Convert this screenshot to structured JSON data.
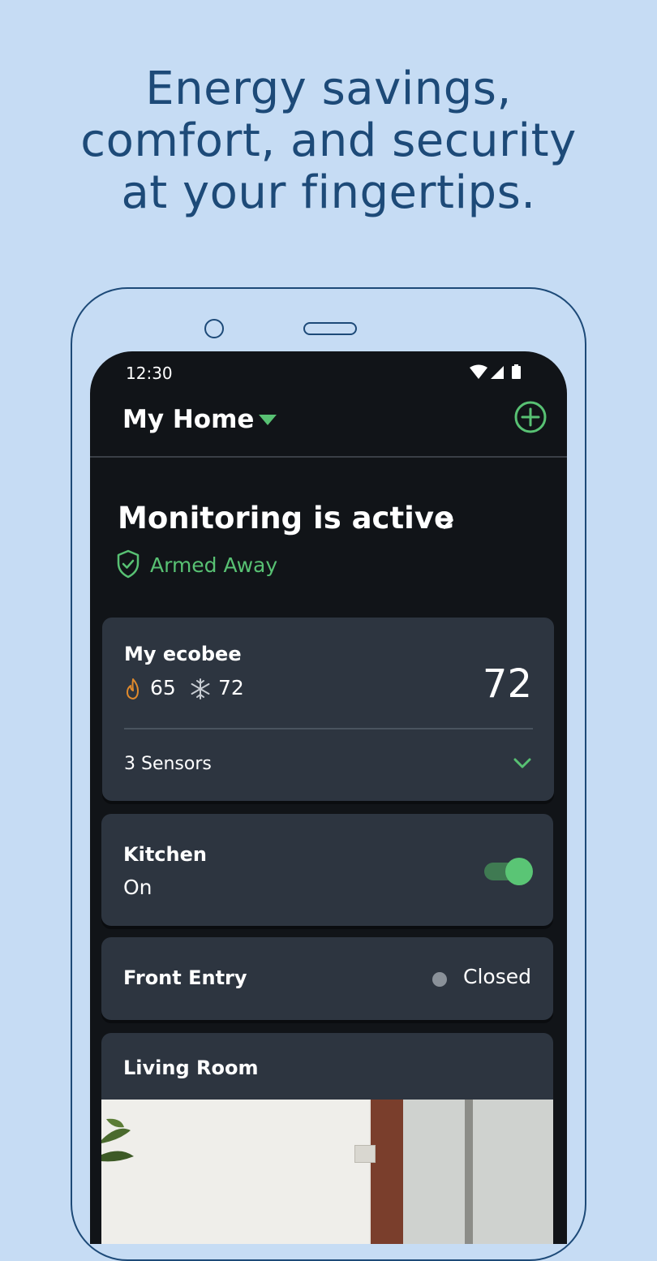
{
  "headline": {
    "line1": "Energy savings,",
    "line2": "comfort, and security",
    "line3": "at your fingertips."
  },
  "status_bar": {
    "time": "12:30"
  },
  "app_bar": {
    "home_name": "My Home"
  },
  "monitoring": {
    "title": "Monitoring is active",
    "mode": "Armed Away"
  },
  "thermostat": {
    "name": "My ecobee",
    "heat_setpoint": "65",
    "cool_setpoint": "72",
    "current_temp": "72",
    "sensors_label": "3 Sensors"
  },
  "kitchen": {
    "name": "Kitchen",
    "state": "On",
    "toggle_on": true
  },
  "front_entry": {
    "name": "Front Entry",
    "state": "Closed"
  },
  "living_room": {
    "name": "Living Room"
  },
  "colors": {
    "background": "#c6dcf4",
    "headline": "#1d4a78",
    "screen": "#111418",
    "card": "#2d3540",
    "accent_green": "#58c173",
    "heat_orange": "#e08a2c"
  }
}
